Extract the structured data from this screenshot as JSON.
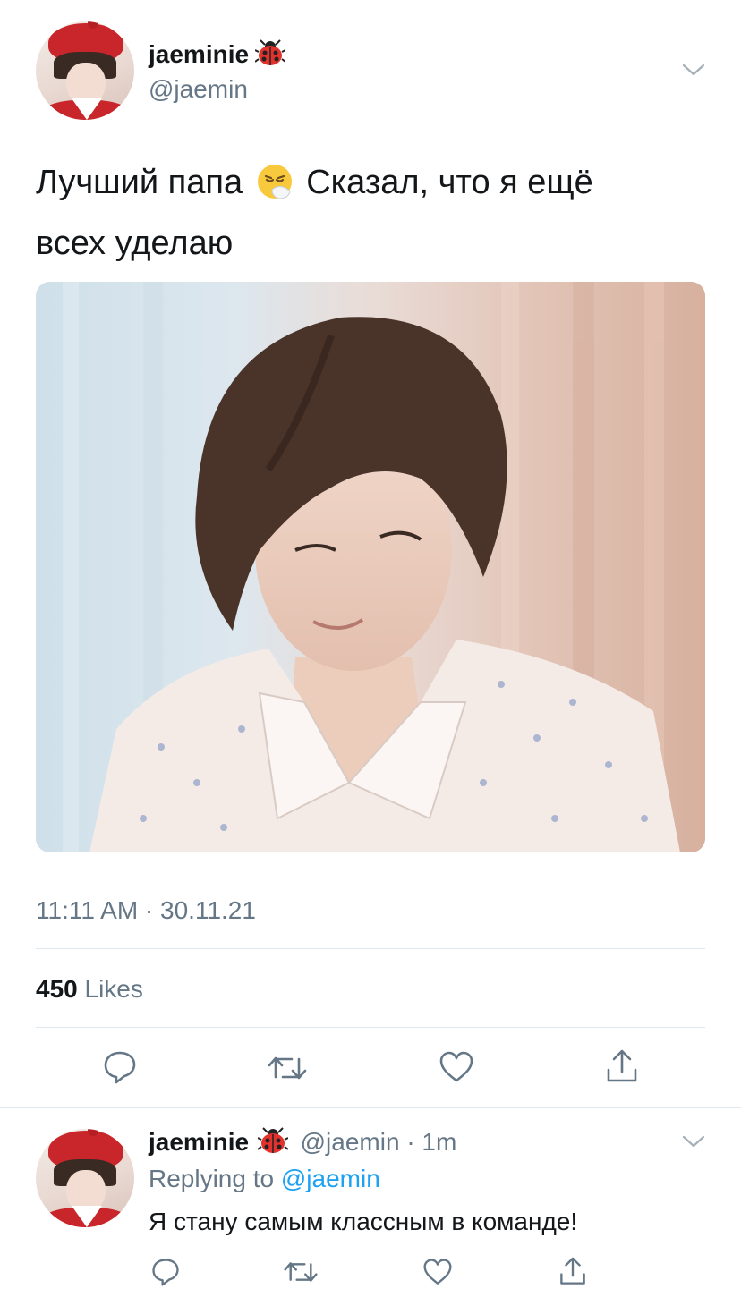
{
  "tweet": {
    "author": {
      "display_name": "jaeminie",
      "handle": "@jaemin",
      "badge_icon": "ladybug-emoji"
    },
    "text_line1_a": "Лучший папа",
    "emoji": "face-with-nose-tissue-emoji",
    "text_line1_b": "Сказал, что я ещё",
    "text_line2": "всех уделаю",
    "media": {
      "kind": "photo",
      "subject": "young man with brown hair in floral pajama shirt"
    },
    "timestamp": "11:11 AM · 30.11.21",
    "likes_count": "450",
    "likes_label": "Likes",
    "actions": [
      "reply-icon",
      "retweet-icon",
      "like-icon",
      "share-icon"
    ]
  },
  "reply": {
    "author": {
      "display_name": "jaeminie",
      "handle": "@jaemin",
      "time": "· 1m"
    },
    "replying_label": "Replying to",
    "replying_handle": "@jaemin",
    "text": "Я стану самым классным в команде!",
    "actions": [
      "reply-icon",
      "retweet-icon",
      "like-icon",
      "share-icon"
    ]
  },
  "colors": {
    "text": "#14171a",
    "muted": "#657786",
    "link": "#1da1f2",
    "divider": "#e1e8ed",
    "background": "#ffffff"
  }
}
